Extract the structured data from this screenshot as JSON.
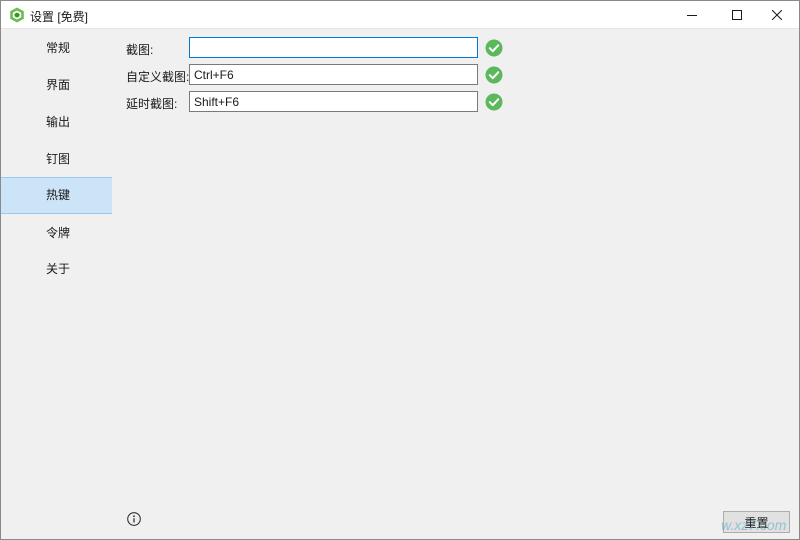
{
  "window": {
    "title": "设置 [免费]"
  },
  "sidebar": {
    "items": [
      {
        "label": "常规",
        "active": false
      },
      {
        "label": "界面",
        "active": false
      },
      {
        "label": "输出",
        "active": false
      },
      {
        "label": "钉图",
        "active": false
      },
      {
        "label": "热键",
        "active": true
      },
      {
        "label": "令牌",
        "active": false
      },
      {
        "label": "关于",
        "active": false
      }
    ]
  },
  "hotkeys": [
    {
      "label": "截图:",
      "value": "",
      "status_icon": "check-circle-icon"
    },
    {
      "label": "自定义截图:",
      "value": "Ctrl+F6",
      "status_icon": "check-circle-icon"
    },
    {
      "label": "延时截图:",
      "value": "Shift+F6",
      "status_icon": "check-circle-icon"
    }
  ],
  "footer": {
    "reset_label": "重置",
    "info_icon": "info-icon"
  },
  "watermark": "w.xz7.com",
  "colors": {
    "accent": "#0078d7",
    "selected_nav_bg": "#cce4f7",
    "status_ok": "#5cb85c",
    "app_icon": "#6abf4b"
  }
}
